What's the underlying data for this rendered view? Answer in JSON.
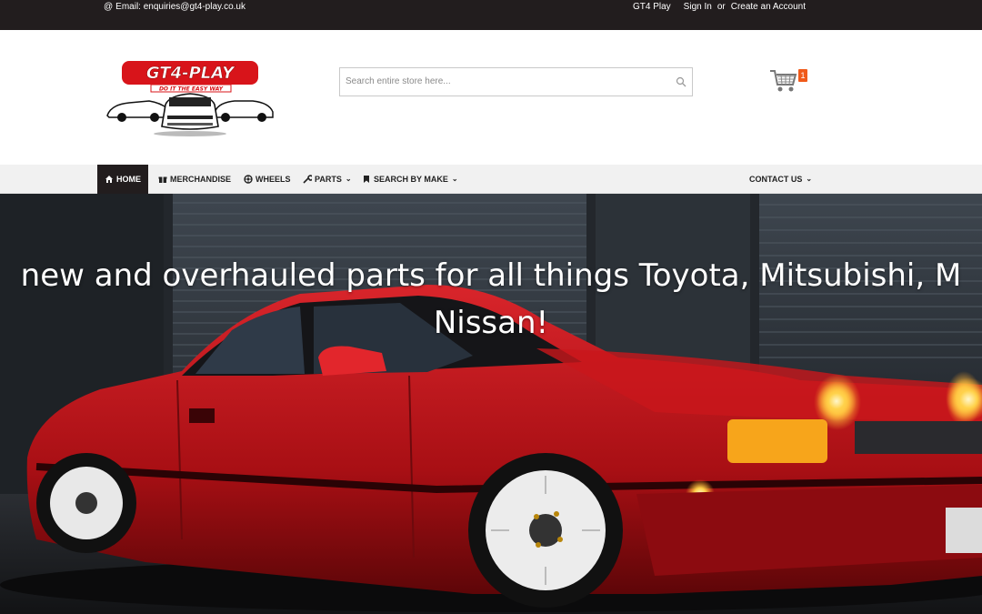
{
  "topbar": {
    "email_label": "Email: enquiries@gt4-play.co.uk",
    "links": [
      "GT4 Play",
      "Sign In",
      "Create an Account"
    ],
    "separator": "or"
  },
  "header": {
    "logo_text": "GT4-PLAY",
    "logo_tagline": "DO IT THE EASY WAY",
    "search_placeholder": "Search entire store here...",
    "cart_count": "1"
  },
  "nav": {
    "home": "HOME",
    "merchandise": "MERCHANDISE",
    "wheels": "WHEELS",
    "parts": "PARTS",
    "search_by_make": "SEARCH BY MAKE",
    "contact_us": "CONTACT US"
  },
  "hero": {
    "line1": "new and overhauled parts for all things Toyota, Mitsubishi, M",
    "line2": "Nissan!"
  },
  "colors": {
    "topbar": "#221d1e",
    "accent": "#f05a1a",
    "car_red": "#c0141a"
  }
}
